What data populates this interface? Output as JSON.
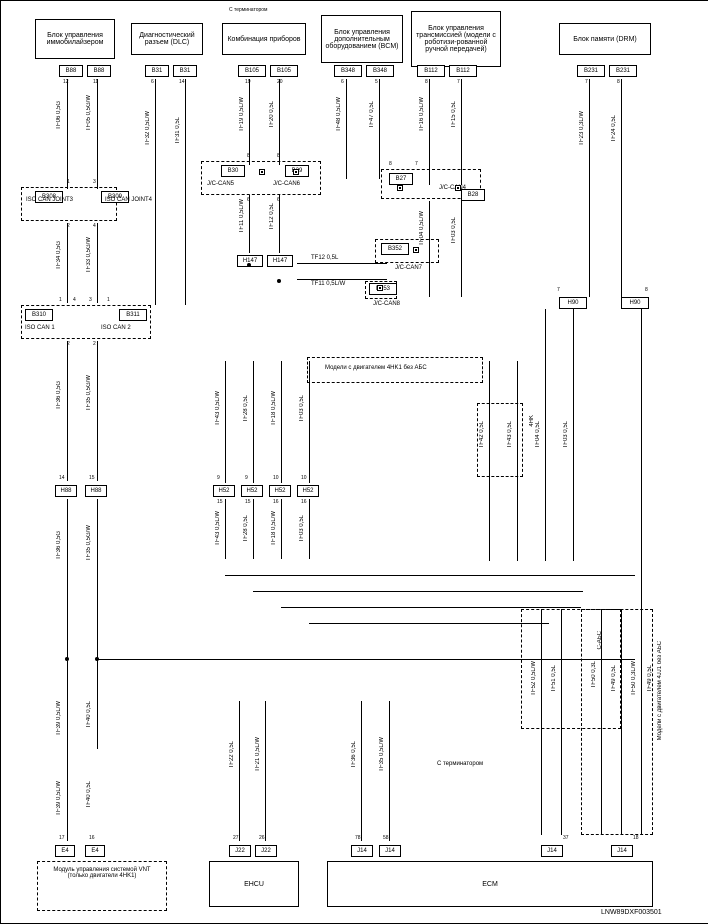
{
  "header": {
    "top_label": "С терминатором"
  },
  "footer": {
    "bottom_label": "С терминатором",
    "doc_id": "LNW89DXF003501"
  },
  "blocks": {
    "b1": "Блок управления иммобилайзером",
    "b2": "Диагностический разъем (DLC)",
    "b3": "Комбинация приборов",
    "b4": "Блок управления дополнительным оборудованием (BCM)",
    "b5": "Блок управления трансмиссией (модели с роботизи-рованной ручной передачей)",
    "b6": "Блок памяти (DRM)",
    "vnt": "Модуль управления системой VNT (только двигатели 4HK1)",
    "ehcu": "EHCU",
    "ecm": "ECM"
  },
  "connectors": {
    "b88a": "B88",
    "b88b": "B88",
    "b31a": "B31",
    "b31b": "B31",
    "b105a": "B105",
    "b105b": "B105",
    "b348a": "B348",
    "b348b": "B348",
    "b112a": "B112",
    "b112b": "B112",
    "b231a": "B231",
    "b231b": "B231",
    "b30": "B30",
    "b29": "B29",
    "b27": "B27",
    "b28": "B28",
    "b352": "B352",
    "b353": "B353",
    "h147a": "H147",
    "h147b": "H147",
    "h90a": "H90",
    "h90b": "H90",
    "b308": "B308",
    "b309": "B309",
    "b310": "B310",
    "b311": "B311",
    "h52a": "H52",
    "h52b": "H52",
    "h52c": "H52",
    "h52d": "H52",
    "h88a": "H88",
    "h88b": "H88",
    "e4a": "E4",
    "e4b": "E4",
    "j22a": "J22",
    "j22b": "J22",
    "j14a": "J14",
    "j14b": "J14",
    "j14c": "J14",
    "j14d": "J14"
  },
  "labels": {
    "iso_joint3": "ISO CAN JOINT3",
    "iso_joint4": "ISO CAN JOINT4",
    "iso_can1": "ISO CAN 1",
    "iso_can2": "ISO CAN 2",
    "jc_can5": "J/C-CAN5",
    "jc_can6": "J/C-CAN6",
    "jc_can4": "J/C-CAN4",
    "jc_can7": "J/C-CAN7",
    "jc_can8": "J/C-CAN8",
    "model_4hk": "4HK",
    "model_4hk1_abs": "Модели с двигателем 4HK1 без АБС",
    "model_4jj1_abs": "Модели с двигателем 4JJ1 без АБС",
    "c_abs": "С-АБС"
  },
  "wires": {
    "tf06": "TF06 0,5G",
    "tf05a": "TF05 0,5G/W",
    "tf05b": "TF05 0,5G/W",
    "tf34": "TF34 0,5G",
    "tf33": "TF33 0,5G/W",
    "tf36": "TF36 0,5G",
    "tf35": "TF35 0,5G/W",
    "tf32": "TF32 0,5L/W",
    "tf31": "TF31 0,5L",
    "tf19": "TF19 0,5L/W",
    "tf20": "TF20 0,5L",
    "tf48": "TF48 0,5L/W",
    "tf47": "TF47 0,5L",
    "tf16": "TF16 0,5L/W",
    "tf15": "TF15 0,5L",
    "tf23": "TF23 0,3L/W",
    "tf24": "TF24 0,5L",
    "tf11": "TF11 0,5L/W",
    "tf11h": "TF11 0,5L/W",
    "tf12": "TF12 0,5L",
    "tf12h": "TF12 0,5L",
    "tf04": "TF04 0,5L/W",
    "tf03a": "TF03 0,5L",
    "tf43top": "TF43 0,5L/W",
    "tf28top": "TF28 0,5L",
    "tf18top": "TF18 0,5L/W",
    "tf03top": "TF03 0,5L",
    "tf43mid": "TF43 0,5L/W",
    "tf28mid": "TF28 0,5L",
    "tf18mid": "TF18 0,5L/W",
    "tf03mid": "TF03 0,5L",
    "tf42": "TF42 0,5L",
    "tf43r": "TF43 0,5L",
    "tf04r": "TF04 0,5L",
    "tf03r": "TF03 0,5L",
    "tf39a": "TF39 0,5L/W",
    "tf40a": "TF40 0,5L",
    "tf39b": "TF39 0,5L/W",
    "tf40b": "TF40 0,5L",
    "tf22": "TF22 0,5L",
    "tf21": "TF21 0,5L/W",
    "tf36b": "TF36 0,5L",
    "tf35b": "TF35 0,5L/W",
    "tf52": "TF52 0,5L/W",
    "tf51": "TF51 0,5L",
    "tf50a": "TF50 0,3L",
    "tf49a": "TF49 0,5L",
    "tf50b": "TF50 0,3L/W",
    "tf49b": "TF49 0,5L"
  },
  "pins": {
    "p1": "1",
    "p2": "2",
    "p3": "3",
    "p4": "4",
    "p5": "5",
    "p6": "6",
    "p7": "7",
    "p8": "8",
    "p9": "9",
    "p10": "10",
    "p11": "11",
    "p12": "12",
    "p14": "14",
    "p15": "15",
    "p16": "16",
    "p17": "17",
    "p18": "18",
    "p19": "19",
    "p20": "20",
    "p26": "26",
    "p27": "27",
    "p37": "37",
    "p58": "58",
    "p78": "78"
  }
}
